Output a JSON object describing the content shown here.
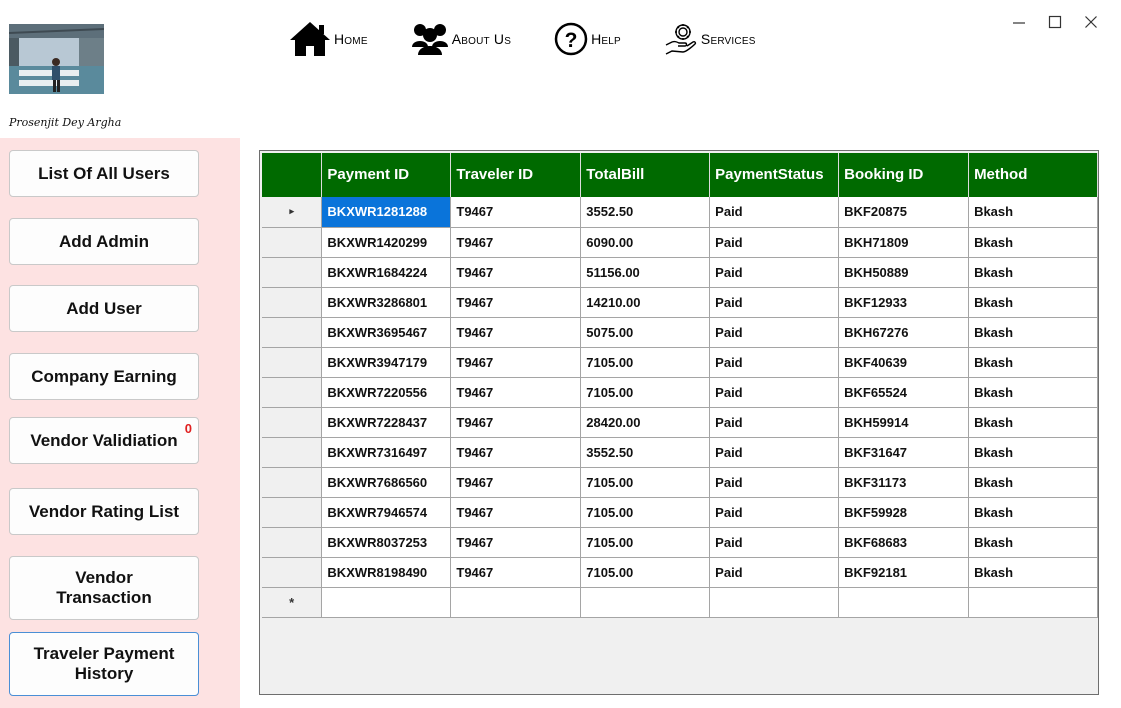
{
  "window": {
    "minimize_glyph": "—",
    "maximize_glyph": "☐",
    "close_glyph": "✕"
  },
  "profile": {
    "name": "Prosenjit Dey Argha"
  },
  "nav": {
    "items": [
      {
        "label": "Home",
        "icon": "home-icon"
      },
      {
        "label": "About Us",
        "icon": "users-icon"
      },
      {
        "label": "Help",
        "icon": "help-icon"
      },
      {
        "label": "Services",
        "icon": "services-icon"
      }
    ]
  },
  "sidebar": {
    "items": [
      {
        "label": "List Of All Users"
      },
      {
        "label": "Add Admin"
      },
      {
        "label": "Add User"
      },
      {
        "label": "Company Earning"
      },
      {
        "label": "Vendor Validiation",
        "badge": "0"
      },
      {
        "label": "Vendor Rating List"
      },
      {
        "label": "Vendor Transaction"
      },
      {
        "label": "Traveler Payment History",
        "active": true
      }
    ]
  },
  "grid": {
    "columns": [
      "Payment ID",
      "Traveler ID",
      "TotalBill",
      "PaymentStatus",
      "Booking ID",
      "Method"
    ],
    "current_row_marker": "▸",
    "new_row_marker": "*",
    "rows": [
      [
        "BKXWR1281288",
        "T9467",
        "3552.50",
        "Paid",
        "BKF20875",
        "Bkash"
      ],
      [
        "BKXWR1420299",
        "T9467",
        "6090.00",
        "Paid",
        "BKH71809",
        "Bkash"
      ],
      [
        "BKXWR1684224",
        "T9467",
        "51156.00",
        "Paid",
        "BKH50889",
        "Bkash"
      ],
      [
        "BKXWR3286801",
        "T9467",
        "14210.00",
        "Paid",
        "BKF12933",
        "Bkash"
      ],
      [
        "BKXWR3695467",
        "T9467",
        "5075.00",
        "Paid",
        "BKH67276",
        "Bkash"
      ],
      [
        "BKXWR3947179",
        "T9467",
        "7105.00",
        "Paid",
        "BKF40639",
        "Bkash"
      ],
      [
        "BKXWR7220556",
        "T9467",
        "7105.00",
        "Paid",
        "BKF65524",
        "Bkash"
      ],
      [
        "BKXWR7228437",
        "T9467",
        "28420.00",
        "Paid",
        "BKH59914",
        "Bkash"
      ],
      [
        "BKXWR7316497",
        "T9467",
        "3552.50",
        "Paid",
        "BKF31647",
        "Bkash"
      ],
      [
        "BKXWR7686560",
        "T9467",
        "7105.00",
        "Paid",
        "BKF31173",
        "Bkash"
      ],
      [
        "BKXWR7946574",
        "T9467",
        "7105.00",
        "Paid",
        "BKF59928",
        "Bkash"
      ],
      [
        "BKXWR8037253",
        "T9467",
        "7105.00",
        "Paid",
        "BKF68683",
        "Bkash"
      ],
      [
        "BKXWR8198490",
        "T9467",
        "7105.00",
        "Paid",
        "BKF92181",
        "Bkash"
      ]
    ]
  }
}
